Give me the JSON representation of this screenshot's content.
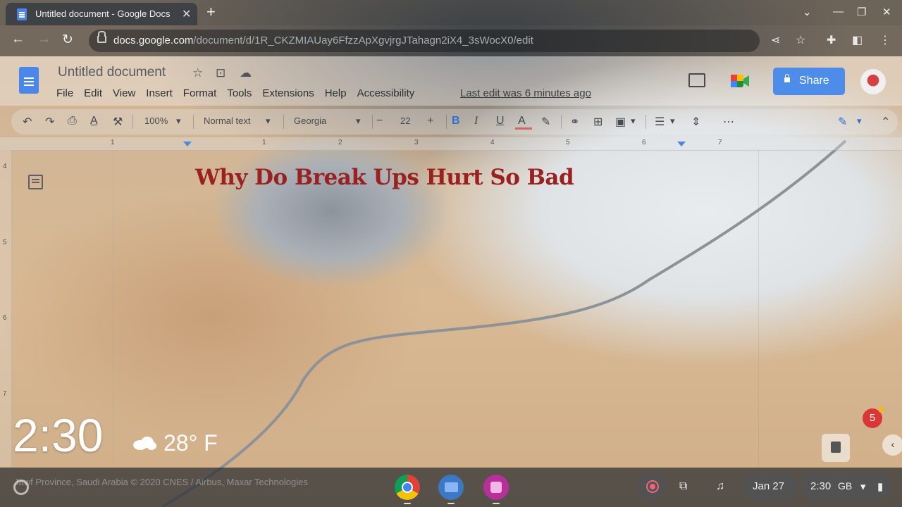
{
  "browser": {
    "tab_title": "Untitled document - Google Docs",
    "tab_close": "✕",
    "new_tab": "+",
    "window_controls": [
      "⌄",
      "—",
      "❐",
      "✕"
    ],
    "nav": {
      "back": "←",
      "forward": "→",
      "reload": "↻"
    },
    "url_host": "docs.google.com",
    "url_path": "/document/d/1R_CKZMIAUay6FfzzApXgvjrgJTahagn2iX4_3sWocX0/edit",
    "omnibox_icons": [
      "share-icon",
      "star-icon",
      "extensions-icon",
      "sidepanel-icon",
      "more-icon"
    ]
  },
  "docs": {
    "title": "Untitled document",
    "menu": [
      "File",
      "Edit",
      "View",
      "Insert",
      "Format",
      "Tools",
      "Extensions",
      "Help",
      "Accessibility"
    ],
    "last_edit": "Last edit was 6 minutes ago",
    "share_label": "Share"
  },
  "toolbar": {
    "zoom": "100%",
    "style": "Normal text",
    "font": "Georgia",
    "font_size": "22",
    "minus": "−",
    "plus": "+",
    "bold": "B",
    "italic": "I",
    "underline": "U",
    "text_color": "A",
    "text_color_value": "#c62b2b"
  },
  "ruler": {
    "numbers": [
      "1",
      "1",
      "2",
      "3",
      "4",
      "5",
      "6",
      "7"
    ],
    "vertical_numbers": [
      "4",
      "5",
      "6",
      "7"
    ]
  },
  "document": {
    "heading": "Why Do Break Ups Hurt So Bad",
    "heading_color": "#9b2020"
  },
  "overlay": {
    "clock": "2:30",
    "temperature": "28° F",
    "notification_count": "5"
  },
  "shelf": {
    "attribution": "Jawf Province, Saudi Arabia © 2020 CNES / Airbus, Maxar Technologies",
    "apps": [
      "chrome-icon",
      "files-icon",
      "gallery-icon"
    ],
    "date": "Jan 27",
    "time": "2:30",
    "locale": "GB"
  }
}
